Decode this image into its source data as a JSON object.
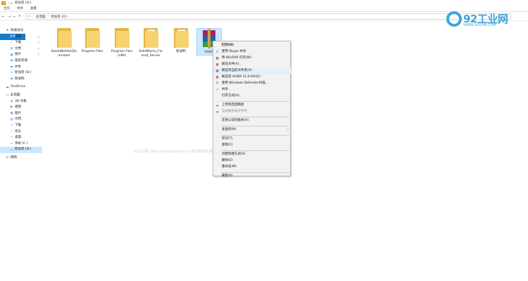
{
  "window": {
    "title": "新加卷 (D:)"
  },
  "ribbon": {
    "tabs": [
      "文件",
      "主页",
      "共享",
      "查看"
    ]
  },
  "address": {
    "crumbs": [
      "此电脑",
      "新加卷 (D:)"
    ]
  },
  "sidebar": {
    "items": [
      {
        "label": "快速访问",
        "icon": "★",
        "level": 1
      },
      {
        "label": "桌面",
        "icon": "▭",
        "level": 2,
        "pinned": true
      },
      {
        "label": "下载",
        "icon": "↓",
        "level": 2,
        "pinned": true
      },
      {
        "label": "文档",
        "icon": "▤",
        "level": 2,
        "pinned": true
      },
      {
        "label": "图片",
        "icon": "▣",
        "level": 2,
        "pinned": true
      },
      {
        "label": "裁剪资源",
        "icon": "▬",
        "level": 2
      },
      {
        "label": "共享",
        "icon": "▬",
        "level": 2
      },
      {
        "label": "新加卷 (D:)",
        "icon": "▭",
        "level": 2
      },
      {
        "label": "新录制",
        "icon": "▬",
        "level": 2
      },
      {
        "label": "OneDrive",
        "icon": "☁",
        "level": 1,
        "gap": true
      },
      {
        "label": "此电脑",
        "icon": "▭",
        "level": 1,
        "gap": true
      },
      {
        "label": "3D 对象",
        "icon": "◈",
        "level": 2
      },
      {
        "label": "视频",
        "icon": "▶",
        "level": 2
      },
      {
        "label": "图片",
        "icon": "▣",
        "level": 2
      },
      {
        "label": "文档",
        "icon": "▤",
        "level": 2
      },
      {
        "label": "下载",
        "icon": "↓",
        "level": 2
      },
      {
        "label": "音乐",
        "icon": "♪",
        "level": 2
      },
      {
        "label": "桌面",
        "icon": "▭",
        "level": 2
      },
      {
        "label": "系统 (C:)",
        "icon": "▭",
        "level": 2
      },
      {
        "label": "新加卷 (D:)",
        "icon": "▭",
        "level": 2,
        "selected": true
      },
      {
        "label": "网络",
        "icon": "◎",
        "level": 1,
        "gap": true
      }
    ]
  },
  "files": [
    {
      "label": "BaiduNetdiskDownload",
      "type": "folder"
    },
    {
      "label": "Program Files",
      "type": "folder"
    },
    {
      "label": "Program Files (x86)",
      "type": "folder"
    },
    {
      "label": "SolidWorks_Flexnet_Server",
      "type": "folder-doc"
    },
    {
      "label": "新录制",
      "type": "folder-doc"
    },
    {
      "label": "UGNX",
      "type": "winrar"
    }
  ],
  "context_menu": {
    "items": [
      {
        "label": "打开(O)",
        "bold": true
      },
      {
        "label": "使用 Skype 共享",
        "icon": "S"
      },
      {
        "label": "用 WinRAR 打开(W)",
        "icon": "▦"
      },
      {
        "label": "解压文件(A)...",
        "icon": "▦"
      },
      {
        "label": "解压到当前文件夹(X)",
        "icon": "▦",
        "highlighted": true
      },
      {
        "label": "解压到 UGNX 11.0-64\\(E)",
        "icon": "▦"
      },
      {
        "label": "使用 Windows Defender扫描...",
        "icon": "⛨"
      },
      {
        "label": "共享",
        "icon": "↗"
      },
      {
        "label": "打开方式(H)..."
      },
      {
        "sep": true
      },
      {
        "label": "上传到百度网盘",
        "icon": "☁"
      },
      {
        "label": "自动备份该文件夹",
        "icon": "☁",
        "disabled": true
      },
      {
        "sep": true
      },
      {
        "label": "还原以前的版本(V)"
      },
      {
        "sep": true
      },
      {
        "label": "发送到(N)",
        "arrow": true
      },
      {
        "sep": true
      },
      {
        "label": "剪切(T)"
      },
      {
        "label": "复制(C)"
      },
      {
        "sep": true
      },
      {
        "label": "创建快捷方式(S)"
      },
      {
        "label": "删除(D)"
      },
      {
        "label": "重命名(M)"
      },
      {
        "sep": true
      },
      {
        "label": "属性(R)"
      }
    ]
  },
  "watermark": {
    "logo_text": "92工业网",
    "logo_url": "WWW.92GYW.COM",
    "overlay_text": "92工业网 http://www.92gyw.com 更多教程资源请访问我们的网站"
  },
  "colors": {
    "accent": "#1979ca",
    "selection": "#cce8ff",
    "logo": "#3ba6d9",
    "folder": "#f7d36f"
  }
}
